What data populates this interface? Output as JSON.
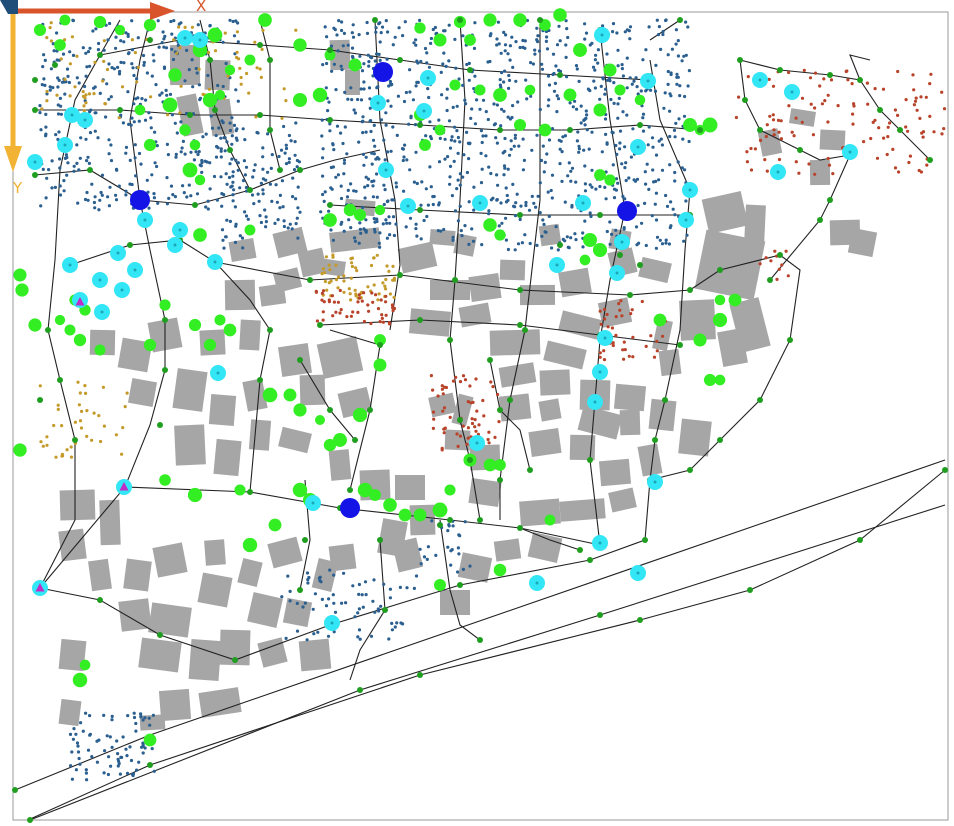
{
  "axes": {
    "x_label": "X",
    "y_label": "Y",
    "x_color": "#d9542b",
    "y_color": "#f2b233",
    "origin_color": "#1f4e79"
  },
  "colors": {
    "building": "#a6a6a6",
    "road": "#222222",
    "junction": "#1f9e1f",
    "tree": "#33ee22",
    "station_small": "#33e6f5",
    "station_large": "#1414e6",
    "triangle_marker": "#c02cc6",
    "dots_blue": "#2a5f8f",
    "dots_gold": "#c49a2a",
    "dots_red": "#b8432a",
    "frame": "#999999"
  },
  "legend_icons": {
    "building": "building-footprint-icon",
    "tree": "tree-canopy-icon",
    "junction": "junction-node-icon",
    "station": "station-marker-icon",
    "triangle": "triangle-marker-icon"
  }
}
